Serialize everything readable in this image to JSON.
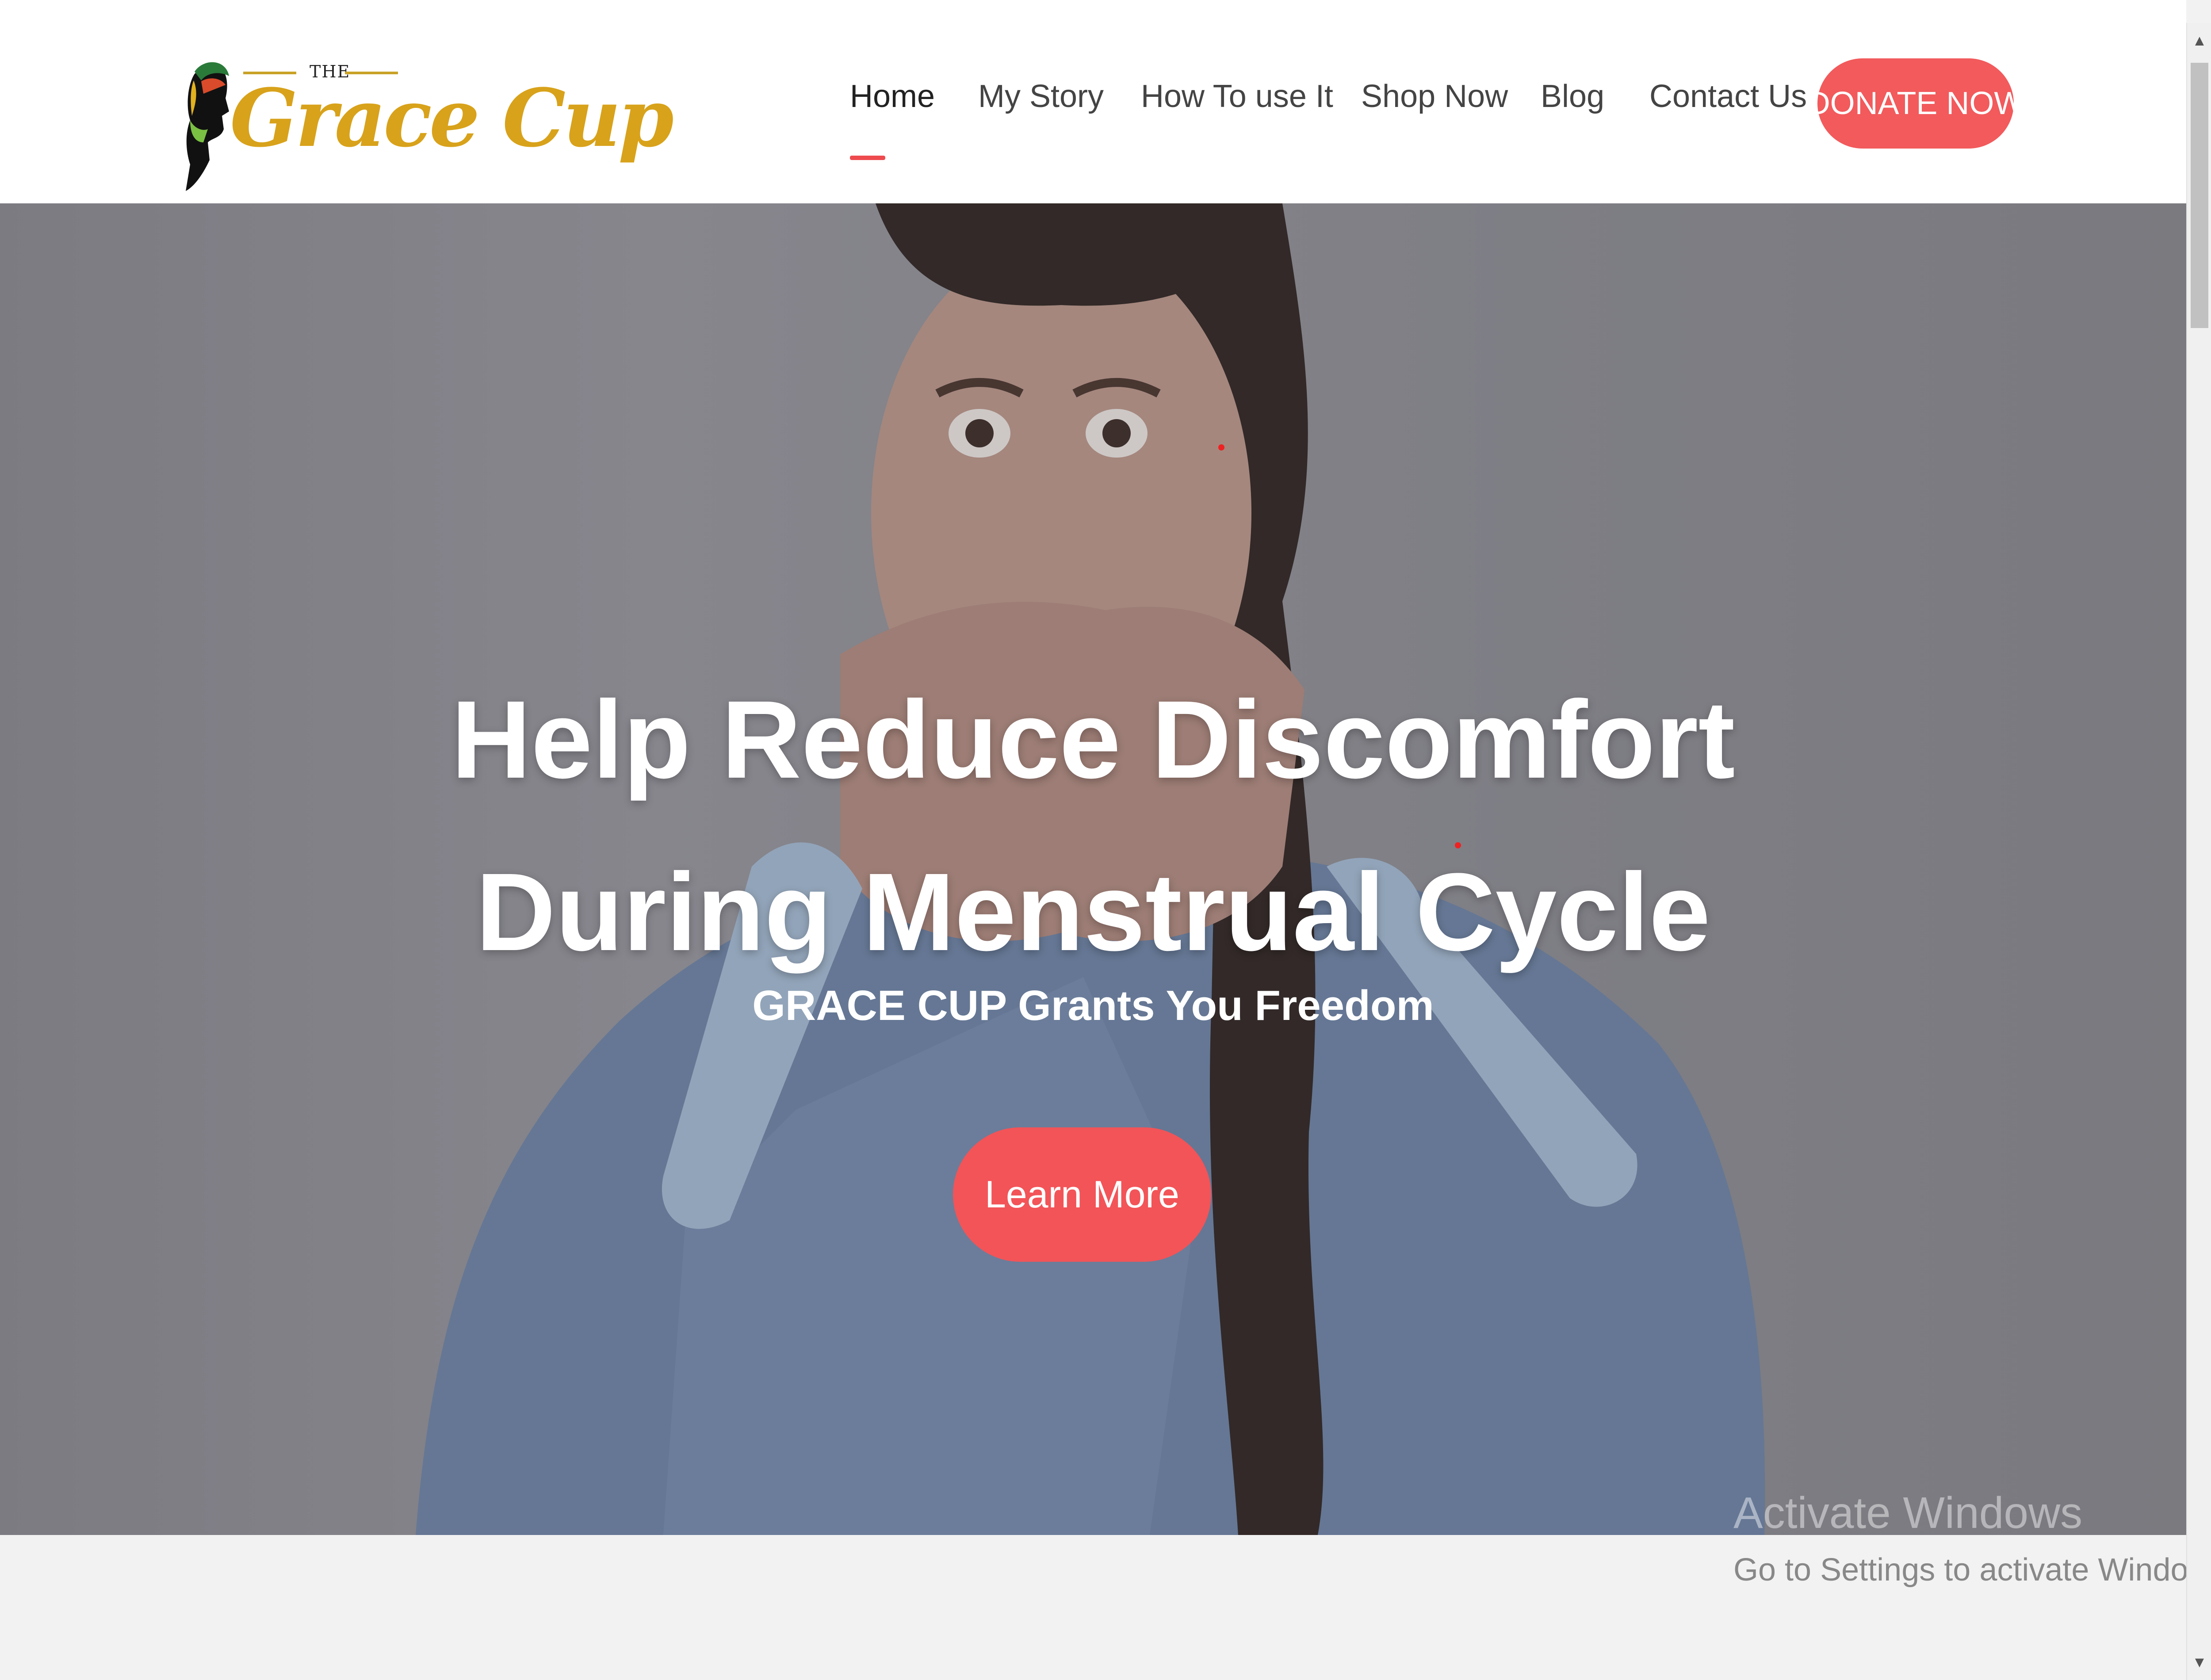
{
  "brand": {
    "logo_small": "THE",
    "logo_name": "Grace Cup"
  },
  "nav": {
    "items": [
      "Home",
      "My Story",
      "How To use It",
      "Shop Now",
      "Blog",
      "Contact Us"
    ],
    "active": "Home",
    "donate_label": "DONATE NOW"
  },
  "hero": {
    "title_line1": "Help Reduce Discomfort",
    "title_line2": "During Menstrual Cycle",
    "subtitle": "GRACE CUP Grants You Freedom",
    "cta_label": "Learn More"
  },
  "watermark": {
    "title": "Activate Windows",
    "subtitle": "Go to Settings to activate Windows."
  },
  "scrollbar": {
    "up_icon": "▲",
    "down_icon": "▼"
  },
  "colors": {
    "accent": "#f25a5c",
    "logo_gold": "#d8a21a",
    "nav_text": "#444444"
  }
}
